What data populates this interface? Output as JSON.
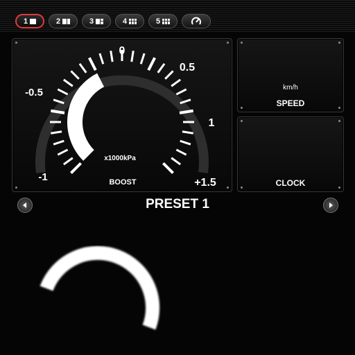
{
  "tabs": [
    {
      "label": "1",
      "layout": "1",
      "active": true
    },
    {
      "label": "2",
      "layout": "2",
      "active": false
    },
    {
      "label": "3",
      "layout": "3",
      "active": false
    },
    {
      "label": "4",
      "layout": "4",
      "active": false
    },
    {
      "label": "5",
      "layout": "5",
      "active": false
    }
  ],
  "tab_extra_icon": "gauge-icon",
  "boost_gauge": {
    "label": "BOOST",
    "unit": "x1000kPa",
    "scale_labels": [
      "-1",
      "-0.5",
      "0",
      "0.5",
      "1",
      "+1.5"
    ],
    "scale_min": -1,
    "scale_max": 1.5,
    "current_value": 0
  },
  "speed_panel": {
    "unit": "km/h",
    "label": "SPEED"
  },
  "clock_panel": {
    "label": "CLOCK"
  },
  "preset": {
    "title": "PRESET 1"
  },
  "colors": {
    "accent": "#e23a3a",
    "needle": "#ffffff",
    "panel_border": "#3a3a3a"
  }
}
